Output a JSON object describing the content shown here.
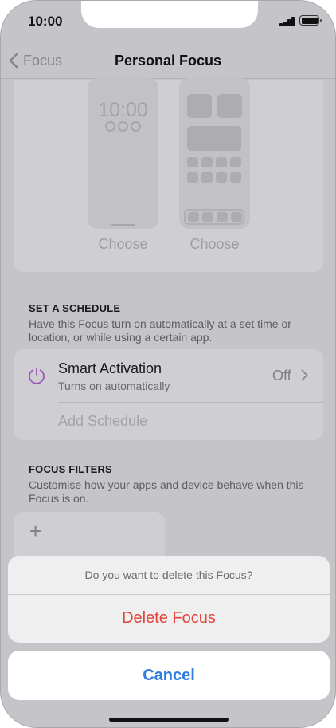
{
  "status_bar": {
    "time": "10:00"
  },
  "nav": {
    "back_label": "Focus",
    "title": "Personal Focus"
  },
  "preview": {
    "lock_time": "10:00",
    "lock_choose_label": "Choose",
    "home_choose_label": "Choose"
  },
  "schedule": {
    "header": "SET A SCHEDULE",
    "description": "Have this Focus turn on automatically at a set time or location, or while using a certain app.",
    "smart_activation": {
      "title": "Smart Activation",
      "subtitle": "Turns on automatically",
      "value": "Off"
    },
    "add_schedule_label": "Add Schedule"
  },
  "filters": {
    "header": "FOCUS FILTERS",
    "description": "Customise how your apps and device behave when this Focus is on.",
    "add_icon": "+"
  },
  "action_sheet": {
    "message": "Do you want to delete this Focus?",
    "delete_label": "Delete Focus",
    "cancel_label": "Cancel"
  },
  "colors": {
    "destructive": "#e4413b",
    "accent": "#2f7de0",
    "smart_activation_icon": "#9b59b6"
  },
  "icons": [
    "chevron-left-icon",
    "power-icon",
    "chevron-right-icon",
    "plus-icon",
    "signal-icon",
    "battery-icon"
  ]
}
